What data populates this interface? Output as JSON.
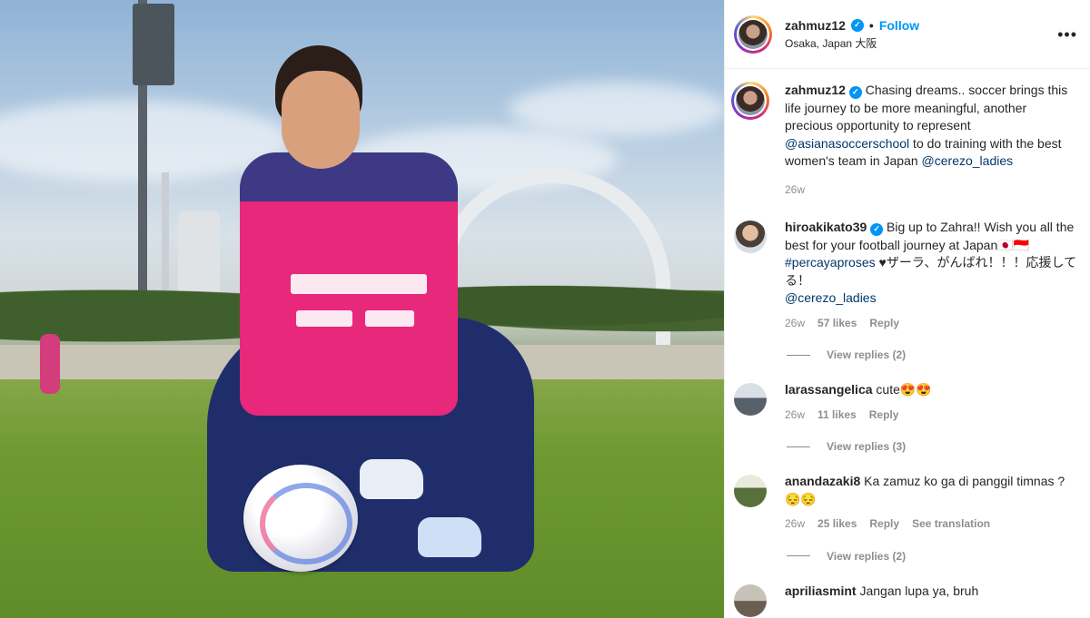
{
  "post": {
    "username": "zahmuz12",
    "verified_mark": "✓",
    "separator": "•",
    "follow_label": "Follow",
    "location": "Osaka, Japan 大阪",
    "more_label": "•••"
  },
  "caption": {
    "username": "zahmuz12",
    "text_before": "Chasing dreams.. soccer brings this life journey to be more meaningful, another precious opportunity to represent ",
    "mention1": "@asianasoccerschool",
    "text_middle": " to do training with the best women's team in Japan ",
    "mention2": "@cerezo_ladies",
    "time": "26w"
  },
  "comments": [
    {
      "username": "hiroakikato39",
      "verified": true,
      "text_before": "Big up to Zahra!! Wish you all the best for your football journey at Japan🇯🇵🇮🇩 ",
      "hashtag": "#percayaproses",
      "text_after": " ♥ザーラ、がんばれ！！！応援してる！",
      "mention": "@cerezo_ladies",
      "time": "26w",
      "likes": "57 likes",
      "reply_label": "Reply",
      "view_replies": "View replies (2)"
    },
    {
      "username": "larassangelica",
      "text": "cute😍😍",
      "time": "26w",
      "likes": "11 likes",
      "reply_label": "Reply",
      "view_replies": "View replies (3)"
    },
    {
      "username": "anandazaki8",
      "text": "Ka zamuz ko ga di panggil timnas ? 😔😔",
      "time": "26w",
      "likes": "25 likes",
      "reply_label": "Reply",
      "translate_label": "See translation",
      "view_replies": "View replies (2)"
    },
    {
      "username": "apriliasmint",
      "text": "Jangan lupa ya, bruh"
    }
  ],
  "colors": {
    "accent_blue": "#0095f6",
    "link_blue": "#00376b",
    "muted_gray": "#8e8e8e",
    "jersey_pink": "#e8287a",
    "jersey_navy": "#2a3b86"
  }
}
